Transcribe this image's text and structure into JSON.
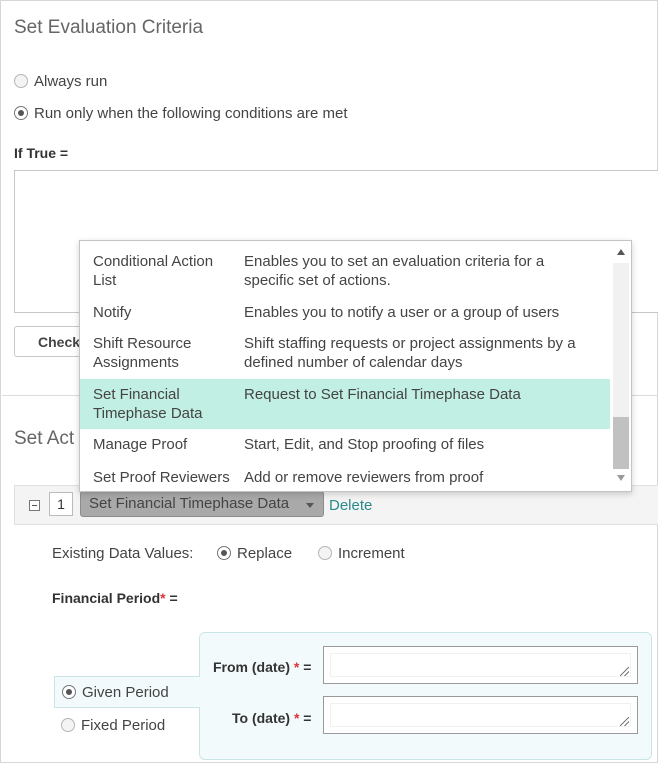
{
  "evaluation": {
    "title": "Set Evaluation Criteria",
    "options": [
      {
        "label": "Always run",
        "checked": false
      },
      {
        "label": "Run only when the following conditions are met",
        "checked": true
      }
    ],
    "if_true_label": "If True =",
    "check_button": "Check"
  },
  "actions": {
    "title_visible": "Set Act",
    "item_number": "1",
    "selected_action": "Set Financial Timephase Data",
    "delete_label": "Delete",
    "existing_data_label": "Existing Data Values:",
    "existing_data_options": [
      {
        "label": "Replace",
        "checked": true
      },
      {
        "label": "Increment",
        "checked": false
      }
    ],
    "financial_period_label": "Financial Period",
    "financial_period_suffix": " =",
    "period_options": [
      {
        "label": "Given Period",
        "checked": true
      },
      {
        "label": "Fixed Period",
        "checked": false
      }
    ],
    "from_date_label": "From (date)",
    "to_date_label": "To (date)",
    "required_mark": "*",
    "equals": " ="
  },
  "dropdown": {
    "items": [
      {
        "name": "Conditional Action List",
        "name_lines": [
          "Conditional Action",
          "List"
        ],
        "desc_lines": [
          "Enables you to set an evaluation criteria for a",
          "specific set of actions."
        ]
      },
      {
        "name": "Notify",
        "name_lines": [
          "Notify"
        ],
        "desc_lines": [
          "Enables you to notify a user or a group of users"
        ]
      },
      {
        "name": "Shift Resource Assignments",
        "name_lines": [
          "Shift Resource",
          "Assignments"
        ],
        "desc_lines": [
          "Shift staffing requests or project assignments by a",
          "defined number of calendar days"
        ]
      },
      {
        "name": "Set Financial Timephase Data",
        "name_lines": [
          "Set Financial",
          "Timephase Data"
        ],
        "desc_lines": [
          "Request to Set Financial Timephase Data"
        ],
        "selected": true
      },
      {
        "name": "Manage Proof",
        "name_lines": [
          "Manage Proof"
        ],
        "desc_lines": [
          "Start, Edit, and Stop proofing of files"
        ]
      },
      {
        "name": "Set Proof Reviewers",
        "name_lines": [
          "Set Proof Reviewers"
        ],
        "desc_lines": [
          "Add or remove reviewers from proof"
        ]
      }
    ],
    "highlight_color": "#c2efe3",
    "scroll_position": 0.85
  },
  "colors": {
    "accent_link": "#2a8a8a",
    "required": "#d9363e",
    "panel_bg": "#f3fafb"
  }
}
